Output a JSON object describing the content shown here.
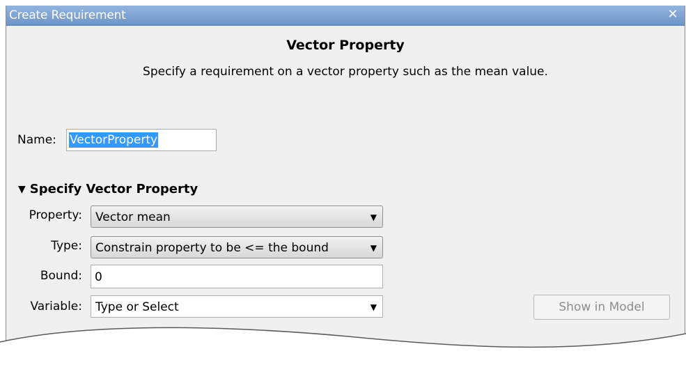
{
  "window": {
    "title": "Create Requirement",
    "close_glyph": "✕"
  },
  "header": {
    "title": "Vector Property",
    "description": "Specify a requirement on a vector property such as the mean value."
  },
  "name_field": {
    "label": "Name:",
    "value": "VectorProperty"
  },
  "section": {
    "title": "Specify Vector Property",
    "expanded": true
  },
  "fields": {
    "property": {
      "label": "Property:",
      "value": "Vector mean"
    },
    "type": {
      "label": "Type:",
      "value": "Constrain property to be <= the bound"
    },
    "bound": {
      "label": "Bound:",
      "value": "0"
    },
    "variable": {
      "label": "Variable:",
      "value": "Type or Select"
    }
  },
  "buttons": {
    "show_in_model": "Show in Model"
  },
  "icons": {
    "dropdown": "chevron-down-icon",
    "collapse": "triangle-down-icon",
    "close": "close-icon"
  },
  "colors": {
    "titlebar": "#7ba1d3",
    "selection": "#3399ff",
    "background": "#f0f0f0"
  }
}
